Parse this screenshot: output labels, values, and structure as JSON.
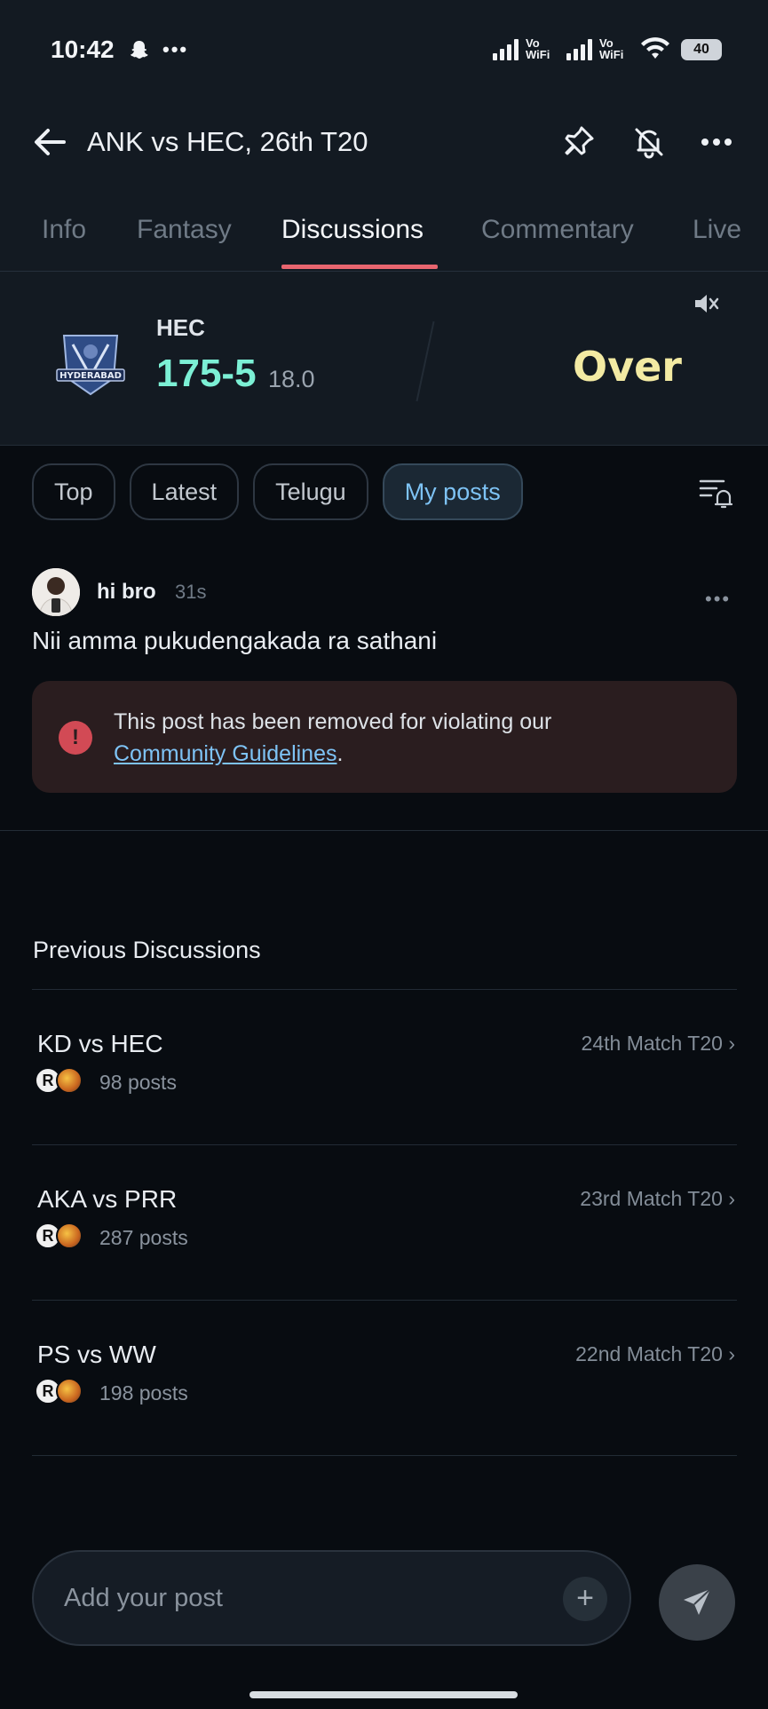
{
  "status_bar": {
    "time": "10:42",
    "left_icons": [
      "snapchat-ghost-icon",
      "more-dots-icon"
    ],
    "vowifi_label": "Vo\nWiFi",
    "battery": "40"
  },
  "header": {
    "title": "ANK vs HEC, 26th T20",
    "icons": [
      "back-arrow-icon",
      "pin-icon",
      "bell-off-icon",
      "more-vertical-icon"
    ]
  },
  "tabs": [
    {
      "label": "Info",
      "active": false
    },
    {
      "label": "Fantasy",
      "active": false
    },
    {
      "label": "Discussions",
      "active": true
    },
    {
      "label": "Commentary",
      "active": false
    },
    {
      "label": "Live",
      "active": false
    }
  ],
  "score": {
    "team": "HEC",
    "logo_text": "HYDERABAD",
    "runs_wickets": "175-5",
    "overs": "18.0",
    "status": "Over",
    "score_color": "#7cf0d5",
    "status_color": "#f3eaa3"
  },
  "filters": [
    {
      "label": "Top",
      "active": false
    },
    {
      "label": "Latest",
      "active": false
    },
    {
      "label": "Telugu",
      "active": false
    },
    {
      "label": "My posts",
      "active": true
    }
  ],
  "post": {
    "username": "hi bro",
    "time_ago": "31s",
    "text": "Nii amma pukudengakada ra sathani",
    "removed_notice": "This post has been removed for violating our",
    "guidelines_link": "Community Guidelines",
    "notice_end": "."
  },
  "previous": {
    "title": "Previous Discussions",
    "items": [
      {
        "title": "KD vs HEC",
        "subtitle": "24th Match T20 ›",
        "posts": "98 posts"
      },
      {
        "title": "AKA vs PRR",
        "subtitle": "23rd Match T20 ›",
        "posts": "287 posts"
      },
      {
        "title": "PS vs WW",
        "subtitle": "22nd Match T20 ›",
        "posts": "198 posts"
      }
    ]
  },
  "composer": {
    "placeholder": "Add your post",
    "plus": "+"
  },
  "colors": {
    "accent_underline": "#e8656f",
    "link": "#7ec3f5",
    "removed_bg": "#2a1d1f"
  }
}
